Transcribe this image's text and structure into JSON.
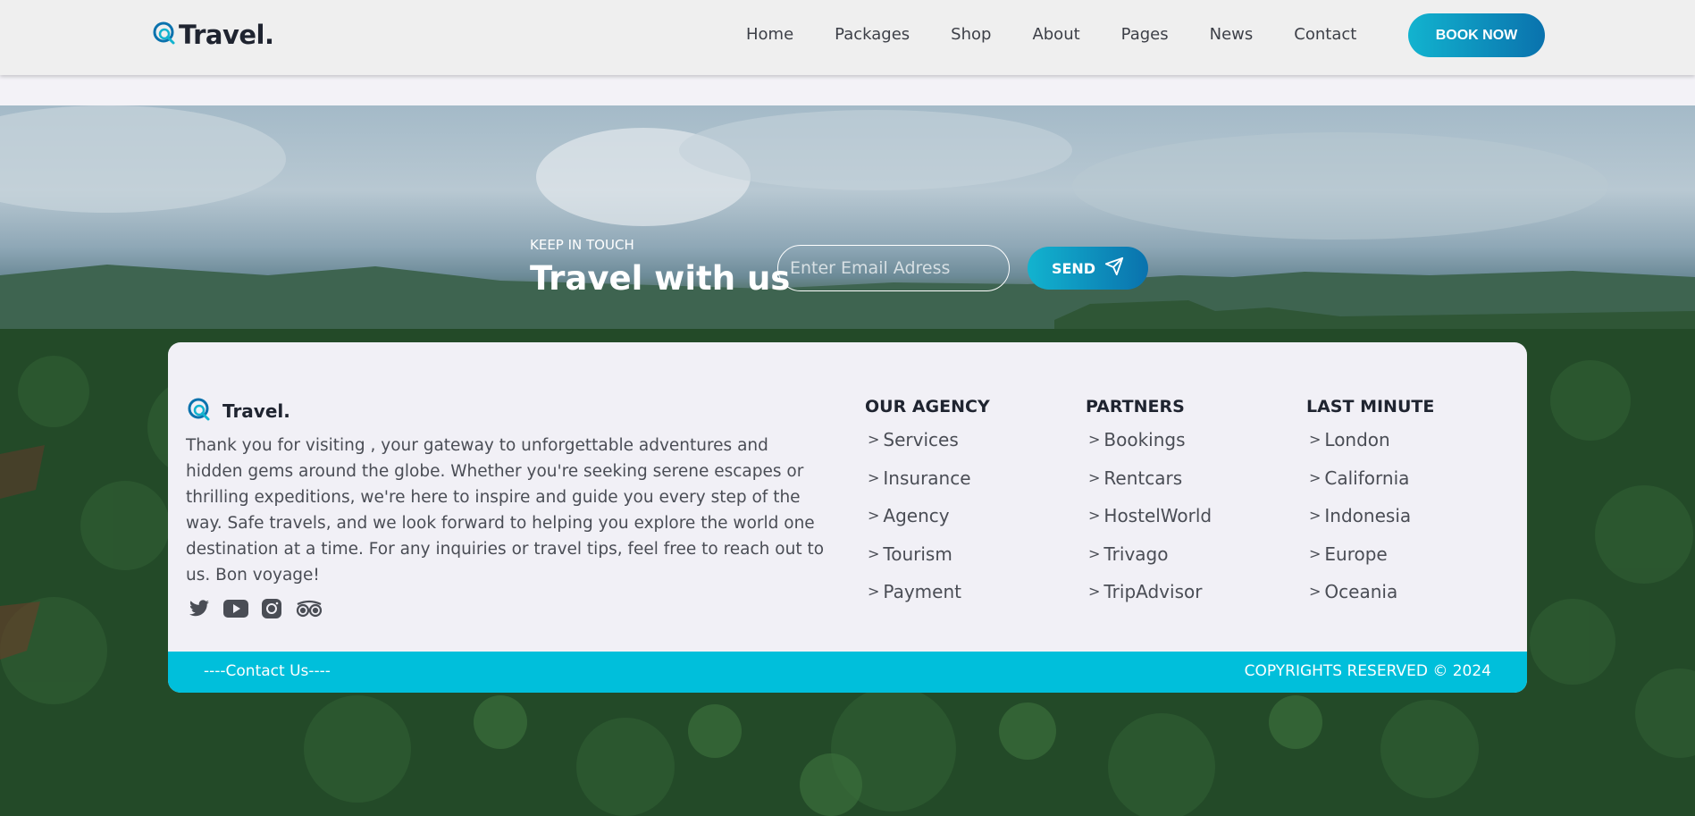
{
  "header": {
    "logo_text": "Travel.",
    "nav": [
      "Home",
      "Packages",
      "Shop",
      "About",
      "Pages",
      "News",
      "Contact"
    ],
    "book_label": "BOOK NOW"
  },
  "newsletter": {
    "eyebrow": "KEEP IN TOUCH",
    "title": "Travel with us",
    "email_placeholder": "Enter Email Adress",
    "send_label": "SEND"
  },
  "footer": {
    "logo_text": "Travel.",
    "about": "Thank you for visiting , your gateway to unforgettable adventures and hidden gems around the globe. Whether you're seeking serene escapes or thrilling expeditions, we're here to inspire and guide you every step of the way. Safe travels, and we look forward to helping you explore the world one destination at a time. For any inquiries or travel tips, feel free to reach out to us. Bon voyage!",
    "socials": [
      "twitter-icon",
      "youtube-icon",
      "instagram-icon",
      "tripadvisor-icon"
    ],
    "columns": [
      {
        "heading": "OUR AGENCY",
        "items": [
          "Services",
          "Insurance",
          "Agency",
          "Tourism",
          "Payment"
        ]
      },
      {
        "heading": "PARTNERS",
        "items": [
          "Bookings",
          "Rentcars",
          "HostelWorld",
          "Trivago",
          "TripAdvisor"
        ]
      },
      {
        "heading": "LAST MINUTE",
        "items": [
          "London",
          "California",
          "Indonesia",
          "Europe",
          "Oceania"
        ]
      }
    ],
    "contact_label": "----Contact Us----",
    "copyright": "COPYRIGHTS RESERVED © 2024"
  },
  "colors": {
    "accent": "#00bfdb",
    "button_gradient_start": "#12b3cf",
    "button_gradient_end": "#0a72ad",
    "dark_text": "#1f2430"
  }
}
